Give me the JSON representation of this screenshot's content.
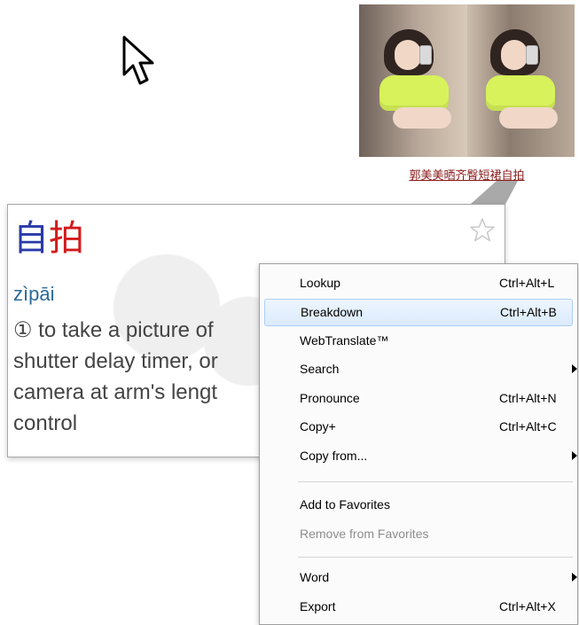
{
  "thumbnail": {
    "caption": "郭美美晒齐臀短裙自拍"
  },
  "dictionary": {
    "headword_char1": "自",
    "headword_char2": "拍",
    "pinyin": "zìpāi",
    "definition_lines": [
      "① to take a picture of",
      "shutter delay timer, or",
      "camera at arm's lengt",
      "control"
    ],
    "colors": {
      "char1": "#2a3aa8",
      "char2": "#d21b1b",
      "pinyin": "#2a6a9a"
    }
  },
  "context_menu": {
    "items": [
      {
        "label": "Lookup",
        "shortcut": "Ctrl+Alt+L"
      },
      {
        "label": "Breakdown",
        "shortcut": "Ctrl+Alt+B",
        "highlighted": true
      },
      {
        "label": "WebTranslate™",
        "shortcut": ""
      },
      {
        "label": "Search",
        "shortcut": "",
        "submenu": true
      },
      {
        "label": "Pronounce",
        "shortcut": "Ctrl+Alt+N"
      },
      {
        "label": "Copy+",
        "shortcut": "Ctrl+Alt+C"
      },
      {
        "label": "Copy from...",
        "shortcut": "",
        "submenu": true
      },
      {
        "label": "Add to Favorites",
        "shortcut": ""
      },
      {
        "label": "Remove from Favorites",
        "shortcut": "",
        "disabled": true
      },
      {
        "label": "Word",
        "shortcut": "",
        "submenu": true
      },
      {
        "label": "Export",
        "shortcut": "Ctrl+Alt+X"
      }
    ]
  },
  "icons": {
    "cursor": "arrow-cursor-icon",
    "favorite": "star-icon",
    "submenu": "chevron-right-icon"
  }
}
